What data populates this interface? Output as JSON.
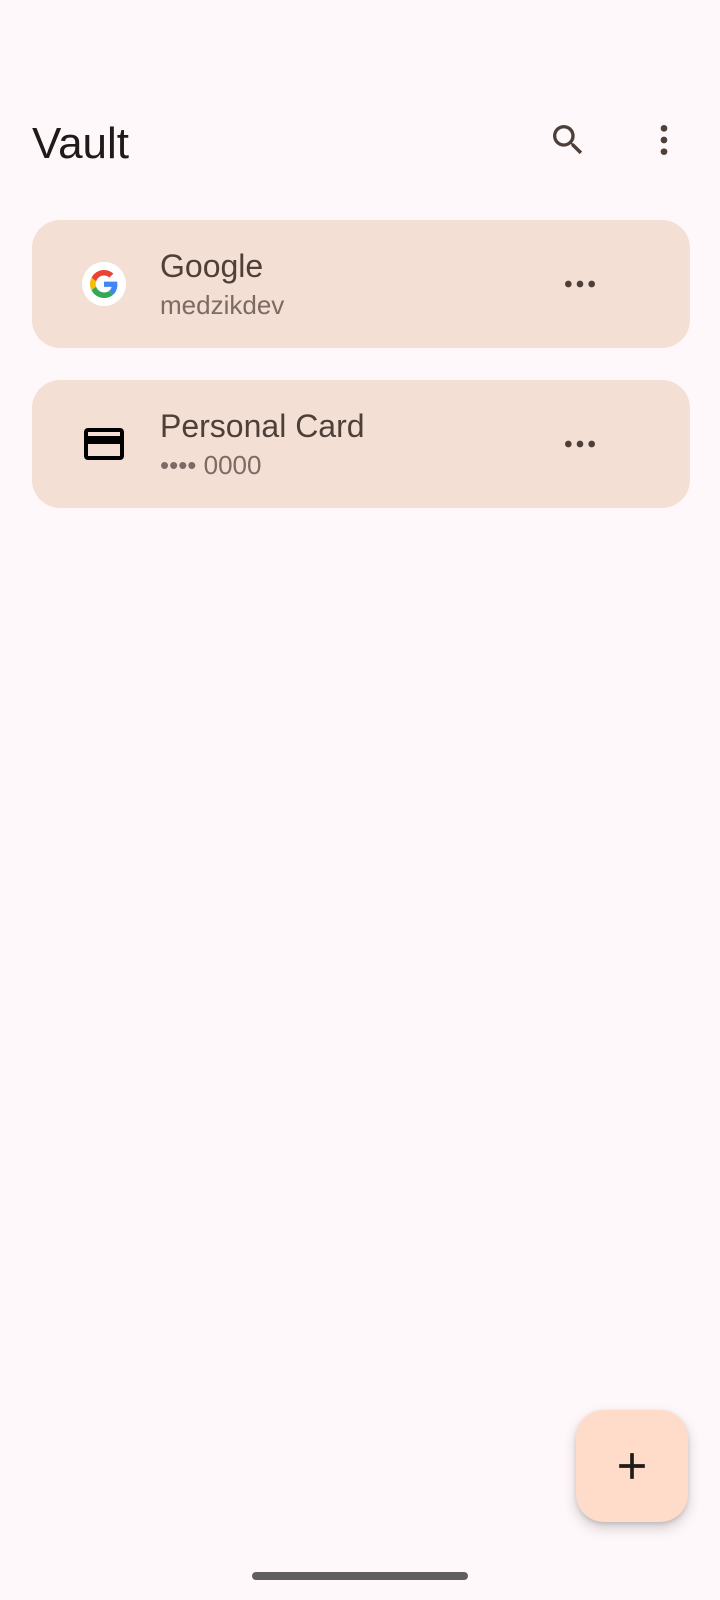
{
  "app": {
    "title": "Vault",
    "colors": {
      "background": "#fff8fa",
      "card": "#f3dfd4",
      "fab": "#ffdbca",
      "text_primary": "#4e3f38",
      "text_secondary": "#7c6b64"
    }
  },
  "top_bar": {
    "title": "Vault",
    "actions": [
      {
        "icon": "search-icon"
      },
      {
        "icon": "more-vert-icon"
      }
    ]
  },
  "items": [
    {
      "icon": "google-icon",
      "title": "Google",
      "subtitle": "medzikdev",
      "menu_icon": "more-horiz-icon"
    },
    {
      "icon": "credit-card-icon",
      "title": "Personal Card",
      "subtitle": "•••• 0000",
      "menu_icon": "more-horiz-icon"
    }
  ],
  "fab": {
    "icon": "add-icon"
  }
}
